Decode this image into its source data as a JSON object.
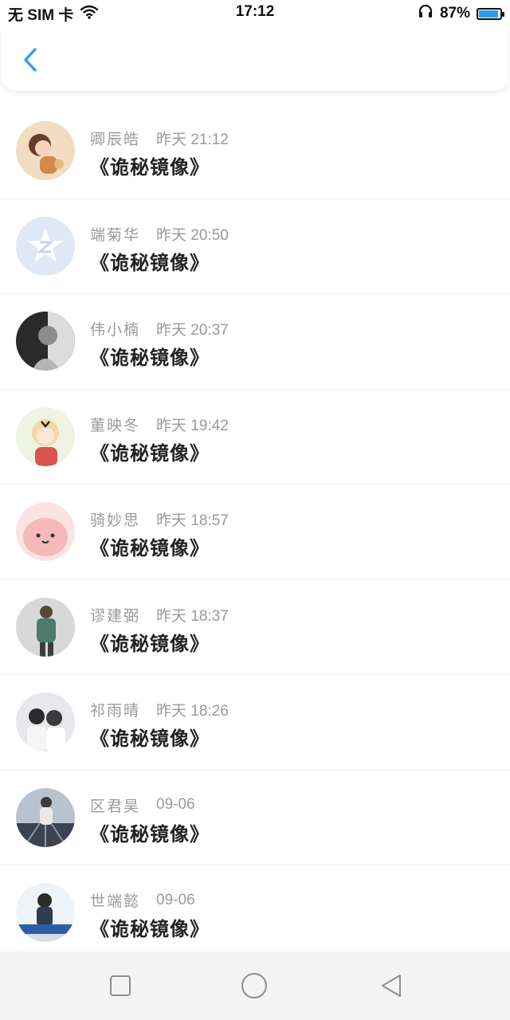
{
  "status": {
    "carrier": "无 SIM 卡",
    "time": "17:12",
    "battery": "87%",
    "battery_level": 0.87
  },
  "header": {
    "back_icon": "chevron-left-icon",
    "accent_color": "#2f9bf0"
  },
  "list": [
    {
      "name": "卿辰皓",
      "time": "昨天 21:12",
      "title": "《诡秘镜像》"
    },
    {
      "name": "端菊华",
      "time": "昨天 20:50",
      "title": "《诡秘镜像》"
    },
    {
      "name": "伟小楠",
      "time": "昨天 20:37",
      "title": "《诡秘镜像》"
    },
    {
      "name": "董映冬",
      "time": "昨天 19:42",
      "title": "《诡秘镜像》"
    },
    {
      "name": "骑妙思",
      "time": "昨天 18:57",
      "title": "《诡秘镜像》"
    },
    {
      "name": "谬建弼",
      "time": "昨天 18:37",
      "title": "《诡秘镜像》"
    },
    {
      "name": "祁雨晴",
      "time": "昨天 18:26",
      "title": "《诡秘镜像》"
    },
    {
      "name": "区君昊",
      "time": "09-06",
      "title": "《诡秘镜像》"
    },
    {
      "name": "世端懿",
      "time": "09-06",
      "title": "《诡秘镜像》"
    }
  ],
  "nav": {
    "recent_icon": "square-icon",
    "home_icon": "circle-icon",
    "back_icon": "triangle-back-icon"
  }
}
